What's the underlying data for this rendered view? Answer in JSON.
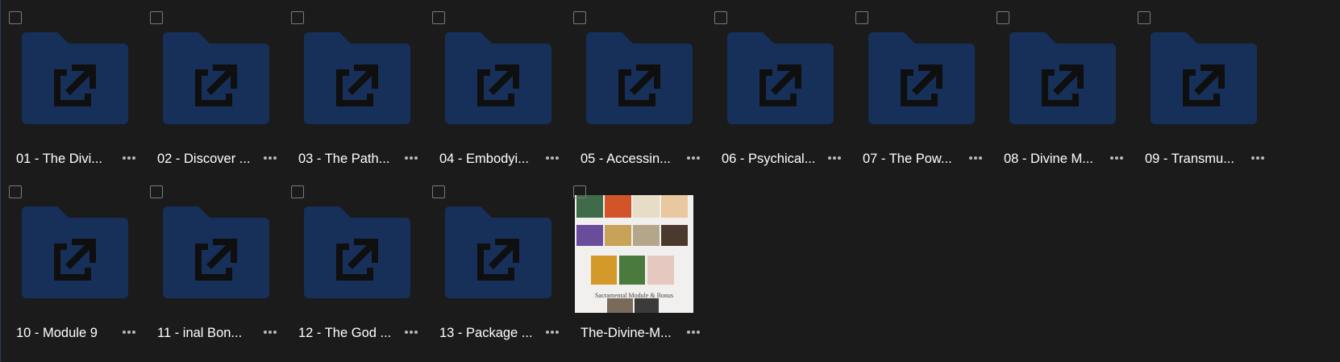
{
  "items": [
    {
      "label": "01 - The Divi...",
      "type": "folder"
    },
    {
      "label": "02 - Discover ...",
      "type": "folder"
    },
    {
      "label": "03 - The Path...",
      "type": "folder"
    },
    {
      "label": "04 - Embodyi...",
      "type": "folder"
    },
    {
      "label": "05 - Accessin...",
      "type": "folder"
    },
    {
      "label": "06 - Psychical...",
      "type": "folder"
    },
    {
      "label": "07 - The Pow...",
      "type": "folder"
    },
    {
      "label": "08 - Divine M...",
      "type": "folder"
    },
    {
      "label": "09 - Transmu...",
      "type": "folder"
    },
    {
      "label": "10 - Module 9",
      "type": "folder"
    },
    {
      "label": "11 - inal Bon...",
      "type": "folder"
    },
    {
      "label": "12 - The God ...",
      "type": "folder"
    },
    {
      "label": "13 - Package ...",
      "type": "folder"
    },
    {
      "label": "The-Divine-M...",
      "type": "image",
      "thumbnail_caption": "Sacramental Module & Bonus"
    }
  ],
  "icons": {
    "folder": "shared-folder-icon",
    "more": "more-options-icon",
    "checkbox": "select-checkbox"
  },
  "colors": {
    "background": "#1b1b1c",
    "folder_fill": "#17305a",
    "folder_glyph": "#0f0f10",
    "label_text": "#ffffff"
  }
}
